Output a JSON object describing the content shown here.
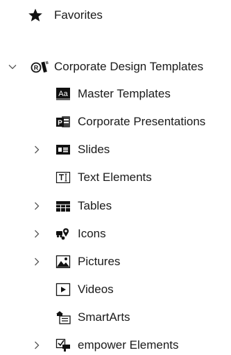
{
  "tree": {
    "favorites": {
      "label": "Favorites",
      "icon": "star-icon"
    },
    "root": {
      "label": "Corporate Design Templates",
      "icon": "brand-logo-icon",
      "expanded": true,
      "children": [
        {
          "label": "Master Templates",
          "icon": "font-sample-icon",
          "expandable": false
        },
        {
          "label": "Corporate Presentations",
          "icon": "powerpoint-icon",
          "expandable": false
        },
        {
          "label": "Slides",
          "icon": "slide-layout-icon",
          "expandable": true
        },
        {
          "label": "Text Elements",
          "icon": "text-box-icon",
          "expandable": false
        },
        {
          "label": "Tables",
          "icon": "table-icon",
          "expandable": true
        },
        {
          "label": "Icons",
          "icon": "icon-set-icon",
          "expandable": true
        },
        {
          "label": "Pictures",
          "icon": "picture-icon",
          "expandable": true
        },
        {
          "label": "Videos",
          "icon": "video-icon",
          "expandable": false
        },
        {
          "label": "SmartArts",
          "icon": "smartart-icon",
          "expandable": false
        },
        {
          "label": "empower Elements",
          "icon": "empower-elements-icon",
          "expandable": true
        }
      ]
    }
  }
}
